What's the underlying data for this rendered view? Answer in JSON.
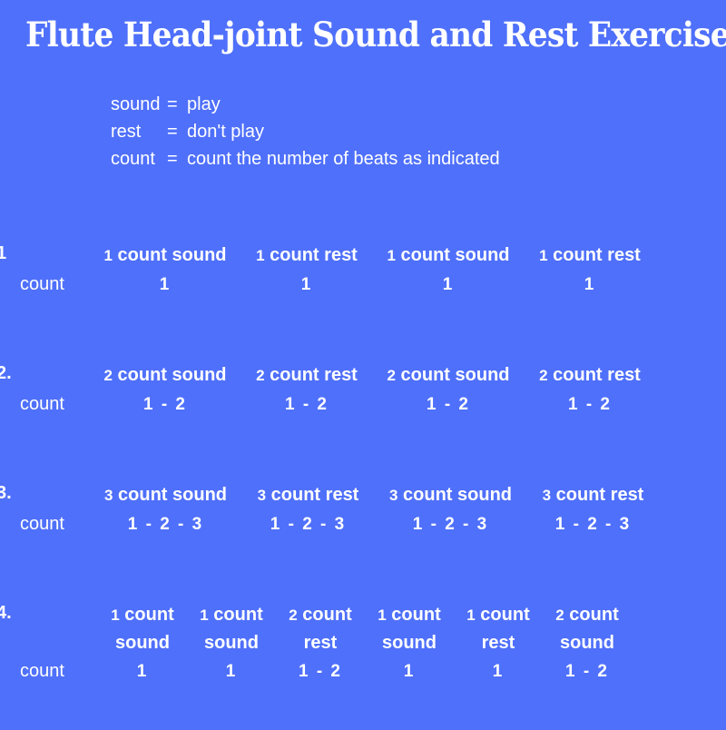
{
  "title": "Flute Head-joint Sound and Rest Exercises",
  "legend": [
    {
      "term": "sound",
      "eq": "=",
      "definition": "play"
    },
    {
      "term": "rest",
      "eq": "=",
      "definition": "don't play"
    },
    {
      "term": "count",
      "eq": "=",
      "definition": "count the number of beats as indicated"
    }
  ],
  "count_label": "count",
  "exercises": [
    {
      "number": "1",
      "columns": [
        {
          "count": "1",
          "unit": "count",
          "action": "sound",
          "beats": "1"
        },
        {
          "count": "1",
          "unit": "count",
          "action": "rest",
          "beats": "1"
        },
        {
          "count": "1",
          "unit": "count",
          "action": "sound",
          "beats": "1"
        },
        {
          "count": "1",
          "unit": "count",
          "action": "rest",
          "beats": "1"
        }
      ]
    },
    {
      "number": "2.",
      "columns": [
        {
          "count": "2",
          "unit": "count",
          "action": "sound",
          "beats": "1 - 2"
        },
        {
          "count": "2",
          "unit": "count",
          "action": "rest",
          "beats": "1 - 2"
        },
        {
          "count": "2",
          "unit": "count",
          "action": "sound",
          "beats": "1 - 2"
        },
        {
          "count": "2",
          "unit": "count",
          "action": "rest",
          "beats": "1 - 2"
        }
      ]
    },
    {
      "number": "3.",
      "columns": [
        {
          "count": "3",
          "unit": "count",
          "action": "sound",
          "beats": "1 - 2 - 3"
        },
        {
          "count": "3",
          "unit": "count",
          "action": "rest",
          "beats": "1 - 2 - 3"
        },
        {
          "count": "3",
          "unit": "count",
          "action": "sound",
          "beats": "1 - 2 - 3"
        },
        {
          "count": "3",
          "unit": "count",
          "action": "rest",
          "beats": "1 - 2 - 3"
        }
      ]
    },
    {
      "number": "4.",
      "columns": [
        {
          "count": "1",
          "unit": "count",
          "action": "sound",
          "beats": "1"
        },
        {
          "count": "1",
          "unit": "count",
          "action": "sound",
          "beats": "1"
        },
        {
          "count": "2",
          "unit": "count",
          "action": "rest",
          "beats": "1 - 2"
        },
        {
          "count": "1",
          "unit": "count",
          "action": "sound",
          "beats": "1"
        },
        {
          "count": "1",
          "unit": "count",
          "action": "rest",
          "beats": "1"
        },
        {
          "count": "2",
          "unit": "count",
          "action": "sound",
          "beats": "1 - 2"
        }
      ]
    }
  ],
  "colors": {
    "background": "#4F70FB",
    "text": "#FFFFFF"
  }
}
